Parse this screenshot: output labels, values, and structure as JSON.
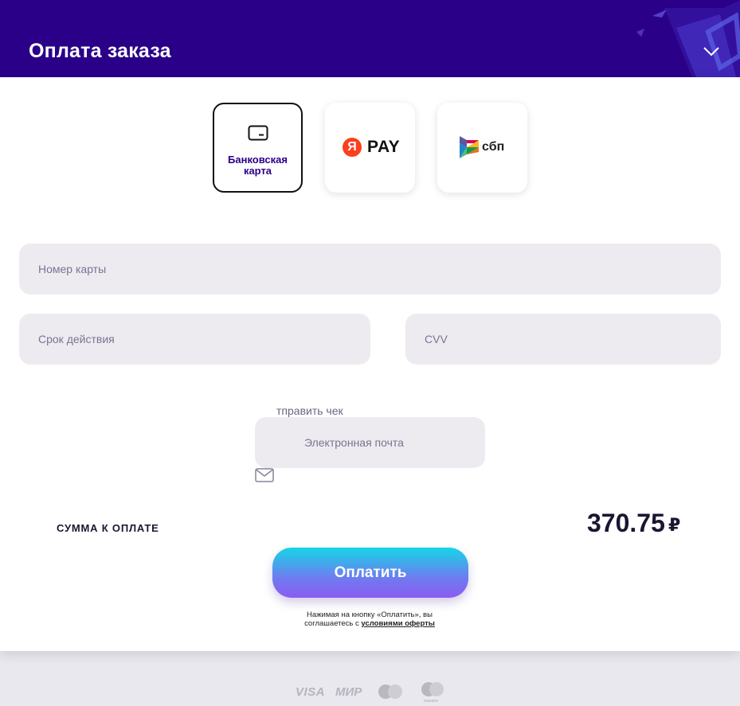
{
  "header": {
    "title": "Оплата заказа"
  },
  "payment_methods": [
    {
      "label": "Банковская карта",
      "icon": "credit-card-icon",
      "selected": true
    },
    {
      "label": "PAY",
      "badge": "Я",
      "icon": "yandex-pay-logo",
      "selected": false
    },
    {
      "label": "сбп",
      "icon": "sbp-logo",
      "selected": false
    }
  ],
  "form": {
    "card_number_placeholder": "Номер карты",
    "expiry_placeholder": "Срок действия",
    "cvv_placeholder": "CVV",
    "receipt_label": "тправить чек",
    "email_placeholder": "Электронная почта"
  },
  "summary": {
    "label": "СУММА К ОПЛАТЕ",
    "amount": "370.75",
    "currency": "₽"
  },
  "pay_button": {
    "label": "Оплатить"
  },
  "agreement": {
    "text": "Нажимая на кнопку «Оплатить», вы соглашаетесь с",
    "link": "условиями оферты"
  },
  "footer_logos": {
    "visa": "VISA",
    "mir": "МИР",
    "maestro": "maestro"
  },
  "colors": {
    "header_bg": "#2a0088",
    "field_bg": "#edebf0",
    "accent_text": "#2a0088",
    "pay_gradient_top": "#14d6e6",
    "pay_gradient_bottom": "#8a5cf2"
  }
}
